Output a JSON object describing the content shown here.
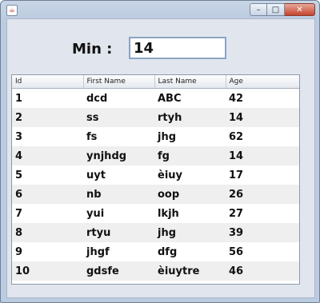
{
  "window": {
    "icon": "java-icon",
    "controls": {
      "minimize": "–",
      "maximize": "□",
      "close": "✕"
    }
  },
  "filter": {
    "label": "Min :",
    "value": "14"
  },
  "table": {
    "columns": [
      "Id",
      "First Name",
      "Last Name",
      "Age"
    ],
    "rows": [
      [
        "1",
        "dcd",
        "ABC",
        "42"
      ],
      [
        "2",
        "ss",
        "rtyh",
        "14"
      ],
      [
        "3",
        "fs",
        "jhg",
        "62"
      ],
      [
        "4",
        "ynjhdg",
        "fg",
        "14"
      ],
      [
        "5",
        "uyt",
        "èiuy",
        "17"
      ],
      [
        "6",
        "nb",
        "oop",
        "26"
      ],
      [
        "7",
        "yui",
        "lkjh",
        "27"
      ],
      [
        "8",
        "rtyu",
        "jhg",
        "39"
      ],
      [
        "9",
        "jhgf",
        "dfg",
        "56"
      ],
      [
        "10",
        "gdsfe",
        "èiuytre",
        "46"
      ]
    ]
  }
}
